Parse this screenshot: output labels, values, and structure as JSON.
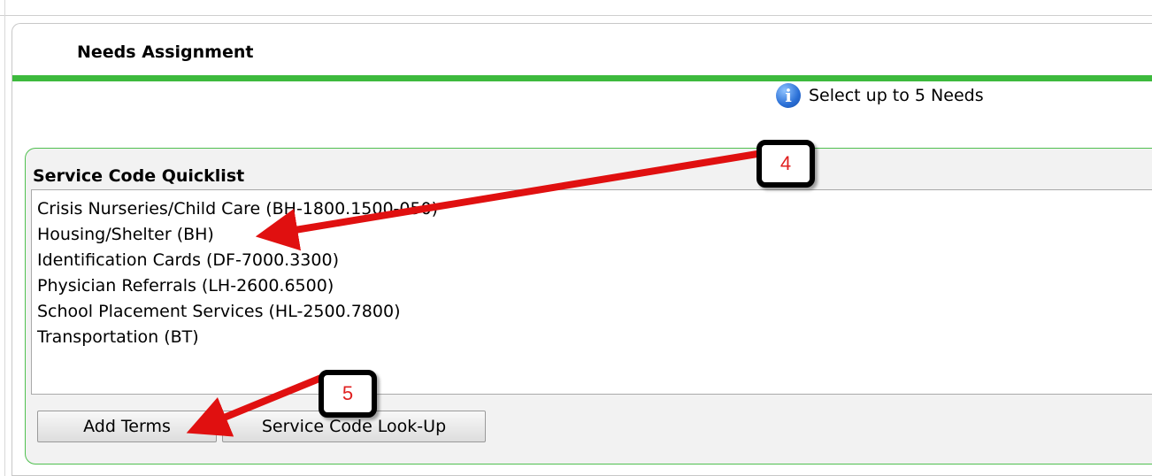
{
  "panel": {
    "title": "Needs Assignment"
  },
  "hint": {
    "icon": "info-icon",
    "text": "Select up to 5 Needs"
  },
  "quicklist": {
    "title": "Service Code Quicklist",
    "items": [
      "Crisis Nurseries/Child Care (BH-1800.1500-050)",
      "Housing/Shelter (BH)",
      "Identification Cards (DF-7000.3300)",
      "Physician Referrals (LH-2600.6500)",
      "School Placement Services (HL-2500.7800)",
      "Transportation (BT)"
    ]
  },
  "buttons": {
    "add_terms": "Add Terms",
    "lookup": "Service Code Look-Up"
  },
  "callouts": {
    "step4": "4",
    "step5": "5"
  },
  "colors": {
    "header_accent": "#3dba3d",
    "callout_text": "#e02020",
    "arrow": "#e01010"
  }
}
